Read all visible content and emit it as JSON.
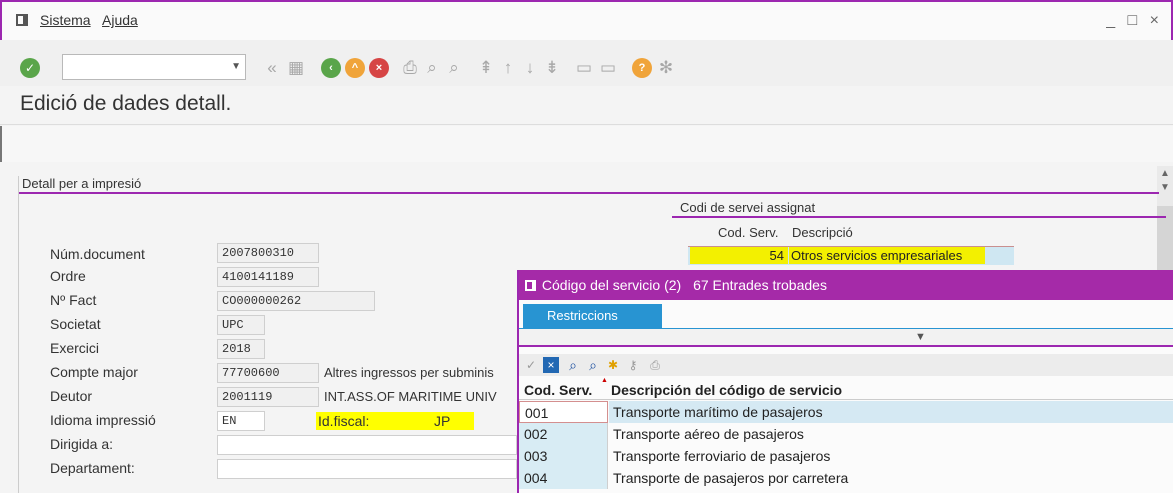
{
  "menubar": {
    "items": [
      "Sistema",
      "Ajuda"
    ],
    "window_controls": "_ □ ×"
  },
  "toolbar": {
    "command_value": "",
    "icons": [
      "check-icon",
      "back-icon",
      "save-icon",
      "back-circle-icon",
      "exit-circle-icon",
      "cancel-circle-icon",
      "print-icon",
      "find-icon",
      "find-next-icon",
      "first-page-icon",
      "previous-page-icon",
      "next-page-icon",
      "last-page-icon",
      "new-session-icon",
      "shortcut-icon",
      "help-icon",
      "layout-icon"
    ]
  },
  "page": {
    "title": "Edició de dades detall."
  },
  "group": {
    "title": "Detall per a impresió"
  },
  "form": {
    "fields": [
      {
        "label": "Núm.document",
        "value": "2007800310"
      },
      {
        "label": "Ordre",
        "value": "4100141189"
      },
      {
        "label": "Nº Fact",
        "value": "CO000000262"
      },
      {
        "label": "Societat",
        "value": "UPC"
      },
      {
        "label": "Exercici",
        "value": "2018"
      },
      {
        "label": "Compte major",
        "value": "77700600",
        "extra": "Altres ingressos per subminis"
      },
      {
        "label": "Deutor",
        "value": "2001119",
        "extra": "INT.ASS.OF MARITIME UNIV"
      },
      {
        "label": "Idioma impressió",
        "value": "EN"
      },
      {
        "label": "Dirigida a:",
        "value": ""
      },
      {
        "label": "Departament:",
        "value": ""
      }
    ],
    "idfiscal_label": "Id.fiscal:",
    "idfiscal_value": "JP"
  },
  "service_assigned": {
    "title": "Codi de servei assignat",
    "head_code": "Cod. Serv.",
    "head_desc": "Descripció",
    "code": "54",
    "description": "Otros servicios empresariales"
  },
  "popup": {
    "title": "Código del servicio (2)",
    "count": "67 Entrades trobades",
    "tab": "Restriccions",
    "col_code": "Cod. Serv.",
    "col_desc": "Descripción del código de servicio",
    "rows": [
      {
        "code": "001",
        "desc": "Transporte marítimo de pasajeros"
      },
      {
        "code": "002",
        "desc": "Transporte aéreo de pasajeros"
      },
      {
        "code": "003",
        "desc": "Transporte ferroviario de pasajeros"
      },
      {
        "code": "004",
        "desc": "Transporte de pasajeros por carretera"
      }
    ]
  },
  "colors": {
    "accent": "#9c27b0",
    "popup_header": "#a52aa8",
    "tab_blue": "#2894d2",
    "highlight": "#f3f000",
    "row_blue": "#d8ecf4"
  }
}
